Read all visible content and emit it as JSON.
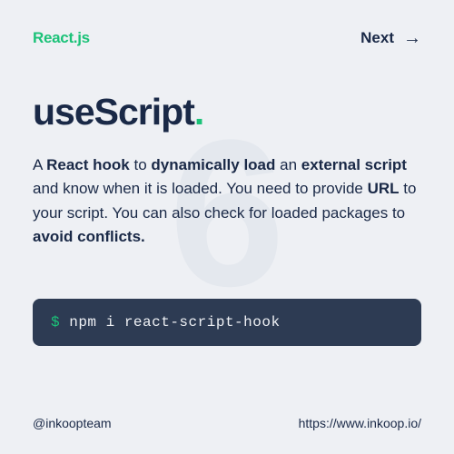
{
  "header": {
    "brand": "React.js",
    "next_label": "Next"
  },
  "watermark": "6",
  "title": {
    "text": "useScript",
    "dot": "."
  },
  "description": {
    "p1": "A ",
    "b1": "React hook",
    "p2": " to ",
    "b2": "dynamically load",
    "p3": " an ",
    "b3": "external script",
    "p4": " and know when it is loaded. You need to provide ",
    "b4": "URL",
    "p5": " to your script. You can also check for loaded packages to ",
    "b5": "avoid conflicts.",
    "p6": ""
  },
  "terminal": {
    "prompt": "$",
    "command": " npm i react-script-hook"
  },
  "footer": {
    "handle": "@inkoopteam",
    "url": "https://www.inkoop.io/"
  }
}
